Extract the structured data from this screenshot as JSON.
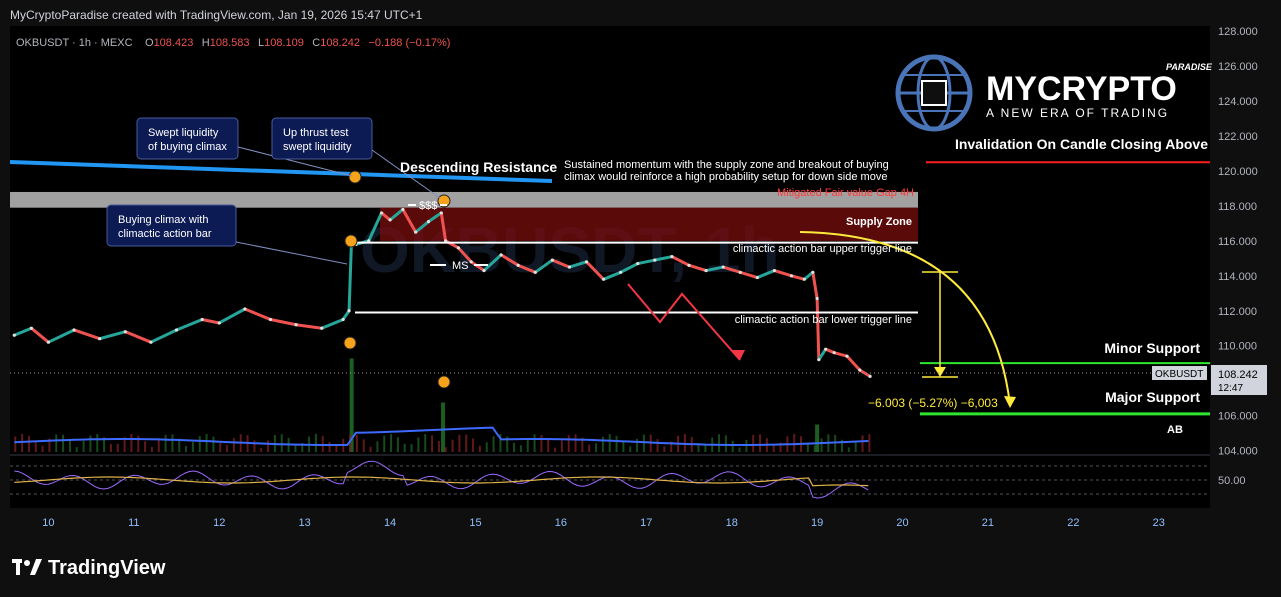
{
  "header": {
    "credit": "MyCryptoParadise created with TradingView.com, Jan 19, 2026 15:47 UTC+1",
    "symbol_line": "OKBUSDT · 1h · MEXC",
    "open_label": "O",
    "open": "108.423",
    "high_label": "H",
    "high": "108.583",
    "low_label": "L",
    "low": "108.109",
    "close_label": "C",
    "close": "108.242",
    "change": "−0.188 (−0.17%)"
  },
  "watermark": "OKBUSDT, 1h",
  "brand": {
    "top": "PARADISE",
    "main": "MYCRYPTO",
    "sub": "A NEW ERA OF TRADING"
  },
  "footer": {
    "logo_text": "TradingView"
  },
  "price_tag": {
    "symbol": "OKBUSDT",
    "price": "108.242",
    "countdown": "12:47"
  },
  "chart_data": {
    "type": "line",
    "title": "",
    "xlabel": "",
    "ylabel": "",
    "x_tick_labels": [
      "10",
      "11",
      "12",
      "13",
      "14",
      "15",
      "16",
      "17",
      "18",
      "19",
      "20",
      "21",
      "22",
      "23"
    ],
    "y_tick_labels": [
      "104.000",
      "106.000",
      "108.000",
      "110.000",
      "112.000",
      "114.000",
      "116.000",
      "118.000",
      "120.000",
      "122.000",
      "124.000",
      "126.000",
      "128.000"
    ],
    "ylim": [
      103.8,
      128.3
    ],
    "xlim": [
      9.55,
      23.6
    ],
    "grid": false,
    "series": [
      {
        "values_x": [
          9.6,
          9.8,
          10,
          10.3,
          10.6,
          10.9,
          11.2,
          11.5,
          11.8,
          12.0,
          12.3,
          12.6,
          12.9,
          13.2,
          13.45,
          13.52,
          13.55,
          13.6,
          13.75,
          13.9,
          14.0,
          14.15,
          14.3,
          14.45,
          14.6,
          14.65,
          14.8,
          14.95,
          15.1,
          15.3,
          15.5,
          15.7,
          15.9,
          16.1,
          16.3,
          16.5,
          16.7,
          16.9,
          17.1,
          17.3,
          17.5,
          17.7,
          17.9,
          18.1,
          18.3,
          18.5,
          18.7,
          18.85,
          18.95,
          19.0,
          19.02,
          19.1,
          19.2,
          19.35,
          19.5,
          19.62
        ],
        "values": [
          110.6,
          111.0,
          110.2,
          110.9,
          110.4,
          110.8,
          110.2,
          110.9,
          111.5,
          111.3,
          112.1,
          111.5,
          111.2,
          111.0,
          111.5,
          112.0,
          116.2,
          115.8,
          116.0,
          117.6,
          117.2,
          117.8,
          116.5,
          117.1,
          117.6,
          116.0,
          115.6,
          114.8,
          114.3,
          115.2,
          114.6,
          114.2,
          114.9,
          114.5,
          114.8,
          113.8,
          114.2,
          114.7,
          114.9,
          115.1,
          114.6,
          114.3,
          114.5,
          114.2,
          113.9,
          114.3,
          114.0,
          113.8,
          114.2,
          112.7,
          109.2,
          109.8,
          109.6,
          109.4,
          108.6,
          108.242
        ]
      }
    ],
    "volume": {
      "spikes": [
        [
          13.55,
          0.85
        ],
        [
          14.62,
          0.45
        ],
        [
          19.0,
          0.25
        ]
      ]
    },
    "levels": [
      {
        "name": "Invalidation On Candle Closing Above",
        "price": 120.5,
        "color": "#ff1e1e"
      },
      {
        "name": "climactic action bar upper trigger line",
        "price": 115.9,
        "color": "#ffffff"
      },
      {
        "name": "climactic action bar lower trigger line",
        "price": 111.9,
        "color": "#ffffff"
      },
      {
        "name": "Minor Support",
        "price": 109.0,
        "color": "#2ee62e"
      },
      {
        "name": "Major Support",
        "price": 106.1,
        "color": "#2ee62e"
      }
    ],
    "zones": [
      {
        "name": "Mitigated Fair value Gap 4H",
        "top": 118.8,
        "bottom": 117.9,
        "color": "#bdbdbd"
      },
      {
        "name": "Supply Zone",
        "top": 117.9,
        "bottom": 116.0,
        "color": "#7a0d0d"
      }
    ],
    "annotations": {
      "swept_buying": "Swept liquidity\nof buying climax",
      "up_thrust": "Up thrust test\nswept liquidity",
      "buying_climax": "Buying climax with\nclimactic action bar",
      "descending_resistance": "Descending Resistance",
      "momentum_note_1": "Sustained momentum with the supply zone and breakout of buying",
      "momentum_note_2": "climax would reinforce a high probability setup for down side move",
      "fvg": "Mitigated Fair value Gap 4H",
      "supply_zone": "Supply Zone",
      "upper_trigger": "climactic action bar upper trigger line",
      "lower_trigger": "climactic action bar lower trigger line",
      "invalidation": "Invalidation On Candle Closing Above",
      "minor_support": "Minor Support",
      "major_support": "Major Support",
      "ab": "AB",
      "sss": "$$$",
      "ms": "MS",
      "measure": "−6.003 (−5.27%) −6,003"
    },
    "rsi": {
      "level_label": "50.00"
    }
  }
}
